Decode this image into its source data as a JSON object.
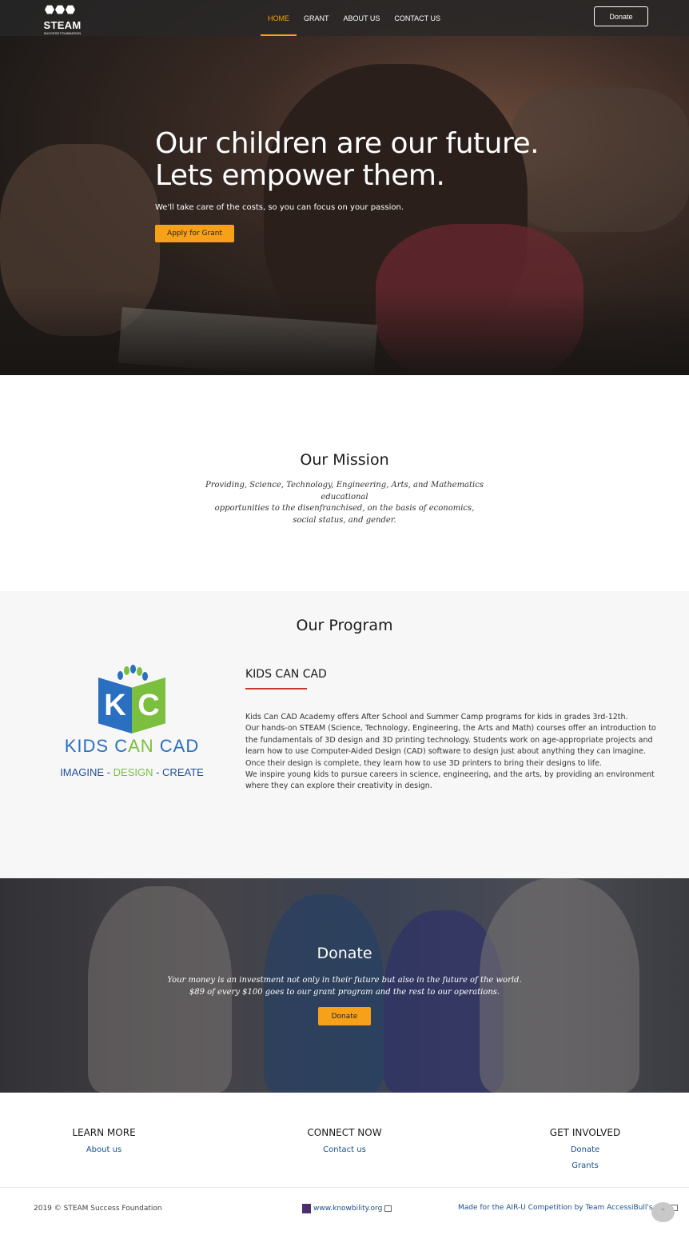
{
  "header": {
    "logo_text": "STEAM",
    "logo_sub": "SUCCESS FOUNDATION",
    "nav": [
      {
        "label": "HOME",
        "active": true
      },
      {
        "label": "GRANT",
        "active": false
      },
      {
        "label": "ABOUT US",
        "active": false
      },
      {
        "label": "CONTACT US",
        "active": false
      }
    ],
    "donate_label": "Donate"
  },
  "hero": {
    "title_line1": "Our children are our future.",
    "title_line2": "Lets empower them.",
    "subtitle": "We'll take care of the costs, so you can focus on your passion.",
    "button_label": "Apply for Grant"
  },
  "mission": {
    "title": "Our Mission",
    "line1": "Providing, Science, Technology, Engineering, Arts, and Mathematics educational",
    "line2": "opportunities to the disenfranchised, on the basis of economics,",
    "line3": "social status, and gender."
  },
  "program": {
    "title": "Our Program",
    "logo": {
      "k": "K",
      "c": "C",
      "name_part1": "KIDS C",
      "name_part2": "AN",
      "name_part3": " CAD",
      "tag1": "IMAGINE - ",
      "tag2": "DESIGN",
      "tag3": " - CREATE"
    },
    "kcc_title": "KIDS CAN CAD",
    "kcc_p1": "Kids Can CAD Academy offers After School and Summer Camp programs for kids in grades 3rd-12th.",
    "kcc_p2": "Our hands-on STEAM (Science, Technology, Engineering, the Arts and Math) courses offer an introduction to the fundamentals of 3D design and 3D printing technology. Students work on age-appropriate projects and learn how to use Computer-Aided Design (CAD) software to design just about anything they can imagine. Once their design is complete, they learn how to use 3D printers to bring their designs to life.",
    "kcc_p3": "We inspire young kids to pursue careers in science, engineering, and the arts, by providing an environment where they can explore their creativity in design."
  },
  "donate": {
    "title": "Donate",
    "line1": "Your money is an investment not only in their future but also in the future of the world.",
    "line2": "$89 of every $100 goes to our grant program and the rest to our operations.",
    "button_label": "Donate"
  },
  "footer": {
    "learn_more": {
      "heading": "LEARN MORE",
      "links": [
        "About us"
      ]
    },
    "connect_now": {
      "heading": "CONNECT NOW",
      "links": [
        "Contact us"
      ]
    },
    "get_involved": {
      "heading": "GET INVOLVED",
      "links": [
        "Donate",
        "Grants"
      ]
    },
    "copyright": "2019 © STEAM Success Foundation",
    "knowbility": "www.knowbility.org",
    "made_for": "Made for the AIR-U Competition by Team AccessiBull's Eye"
  },
  "colors": {
    "accent": "#f7a11a",
    "link": "#1a4f8a",
    "kc_blue": "#2a6fc0",
    "kc_green": "#7bbf3e",
    "rule_red": "#c0392b"
  },
  "icons": [
    "steam-logo-icon",
    "external-link-icon",
    "knowbility-icon",
    "back-to-top-icon"
  ]
}
